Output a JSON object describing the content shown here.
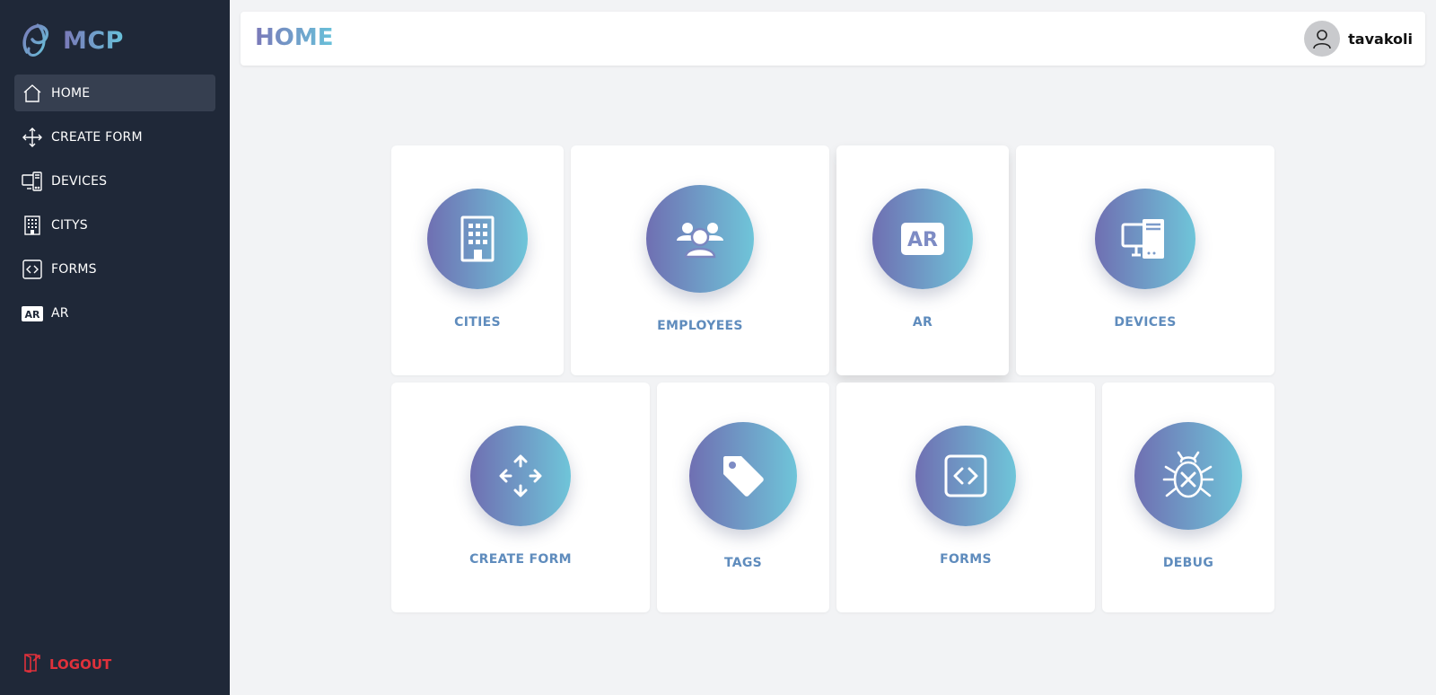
{
  "app": {
    "brand": "MCP"
  },
  "sidebar": {
    "items": [
      {
        "label": "HOME",
        "icon": "home-icon",
        "active": true
      },
      {
        "label": "CREATE FORM",
        "icon": "move-arrows-icon"
      },
      {
        "label": "DEVICES",
        "icon": "devices-icon"
      },
      {
        "label": "CITYS",
        "icon": "building-icon"
      },
      {
        "label": "FORMS",
        "icon": "code-icon"
      },
      {
        "label": "AR",
        "icon": "ar-icon"
      }
    ],
    "logout": "LOGOUT"
  },
  "header": {
    "title": "HOME",
    "username": "tavakoli"
  },
  "cards": [
    {
      "label": "CITIES",
      "icon": "building-icon"
    },
    {
      "label": "EMPLOYEES",
      "icon": "users-icon"
    },
    {
      "label": "AR",
      "icon": "ar-icon"
    },
    {
      "label": "DEVICES",
      "icon": "devices-icon"
    },
    {
      "label": "CREATE FORM",
      "icon": "move-arrows-icon"
    },
    {
      "label": "TAGS",
      "icon": "tag-icon"
    },
    {
      "label": "FORMS",
      "icon": "code-icon"
    },
    {
      "label": "DEBUG",
      "icon": "bug-icon"
    }
  ],
  "colors": {
    "accent_start": "#6f6fb2",
    "accent_end": "#6fc5d9",
    "sidebar_bg": "#1f2838",
    "logout": "#e0313b",
    "card_label": "#5f8cbd"
  }
}
